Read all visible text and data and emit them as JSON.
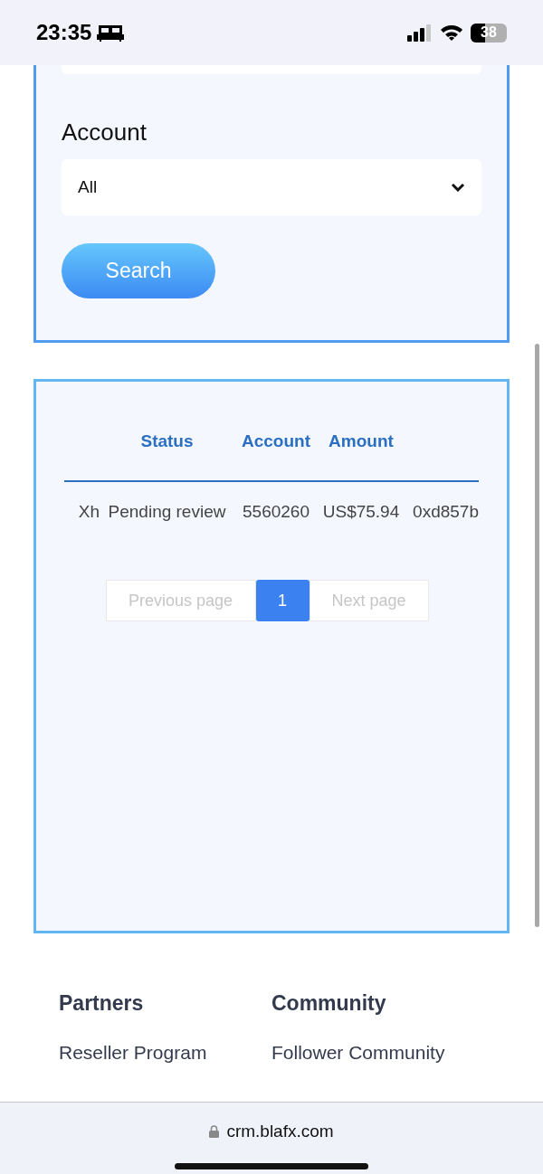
{
  "status_bar": {
    "time": "23:35",
    "battery": "38"
  },
  "filter": {
    "account_label": "Account",
    "account_value": "All",
    "search_button": "Search"
  },
  "table": {
    "columns": [
      "",
      "Status",
      "Account",
      "Amount",
      ""
    ],
    "rows": [
      {
        "cells": [
          "Xh",
          "Pending review",
          "5560260",
          "US$75.94",
          "0xd857b"
        ]
      }
    ]
  },
  "pagination": {
    "previous": "Previous page",
    "pages": [
      {
        "label": "1",
        "selected": true
      }
    ],
    "next": "Next page"
  },
  "footer": {
    "columns": [
      {
        "title": "Partners",
        "links": [
          "Reseller Program"
        ]
      },
      {
        "title": "Community",
        "links": [
          "Follower Community"
        ]
      }
    ]
  },
  "browser": {
    "url": "crm.blafx.com"
  }
}
